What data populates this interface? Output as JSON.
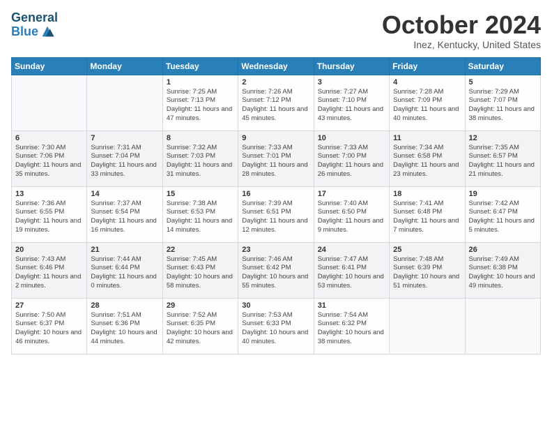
{
  "header": {
    "logo_line1": "General",
    "logo_line2": "Blue",
    "month": "October 2024",
    "location": "Inez, Kentucky, United States"
  },
  "days_of_week": [
    "Sunday",
    "Monday",
    "Tuesday",
    "Wednesday",
    "Thursday",
    "Friday",
    "Saturday"
  ],
  "weeks": [
    [
      {
        "day": "",
        "info": ""
      },
      {
        "day": "",
        "info": ""
      },
      {
        "day": "1",
        "info": "Sunrise: 7:25 AM\nSunset: 7:13 PM\nDaylight: 11 hours and 47 minutes."
      },
      {
        "day": "2",
        "info": "Sunrise: 7:26 AM\nSunset: 7:12 PM\nDaylight: 11 hours and 45 minutes."
      },
      {
        "day": "3",
        "info": "Sunrise: 7:27 AM\nSunset: 7:10 PM\nDaylight: 11 hours and 43 minutes."
      },
      {
        "day": "4",
        "info": "Sunrise: 7:28 AM\nSunset: 7:09 PM\nDaylight: 11 hours and 40 minutes."
      },
      {
        "day": "5",
        "info": "Sunrise: 7:29 AM\nSunset: 7:07 PM\nDaylight: 11 hours and 38 minutes."
      }
    ],
    [
      {
        "day": "6",
        "info": "Sunrise: 7:30 AM\nSunset: 7:06 PM\nDaylight: 11 hours and 35 minutes."
      },
      {
        "day": "7",
        "info": "Sunrise: 7:31 AM\nSunset: 7:04 PM\nDaylight: 11 hours and 33 minutes."
      },
      {
        "day": "8",
        "info": "Sunrise: 7:32 AM\nSunset: 7:03 PM\nDaylight: 11 hours and 31 minutes."
      },
      {
        "day": "9",
        "info": "Sunrise: 7:33 AM\nSunset: 7:01 PM\nDaylight: 11 hours and 28 minutes."
      },
      {
        "day": "10",
        "info": "Sunrise: 7:33 AM\nSunset: 7:00 PM\nDaylight: 11 hours and 26 minutes."
      },
      {
        "day": "11",
        "info": "Sunrise: 7:34 AM\nSunset: 6:58 PM\nDaylight: 11 hours and 23 minutes."
      },
      {
        "day": "12",
        "info": "Sunrise: 7:35 AM\nSunset: 6:57 PM\nDaylight: 11 hours and 21 minutes."
      }
    ],
    [
      {
        "day": "13",
        "info": "Sunrise: 7:36 AM\nSunset: 6:55 PM\nDaylight: 11 hours and 19 minutes."
      },
      {
        "day": "14",
        "info": "Sunrise: 7:37 AM\nSunset: 6:54 PM\nDaylight: 11 hours and 16 minutes."
      },
      {
        "day": "15",
        "info": "Sunrise: 7:38 AM\nSunset: 6:53 PM\nDaylight: 11 hours and 14 minutes."
      },
      {
        "day": "16",
        "info": "Sunrise: 7:39 AM\nSunset: 6:51 PM\nDaylight: 11 hours and 12 minutes."
      },
      {
        "day": "17",
        "info": "Sunrise: 7:40 AM\nSunset: 6:50 PM\nDaylight: 11 hours and 9 minutes."
      },
      {
        "day": "18",
        "info": "Sunrise: 7:41 AM\nSunset: 6:48 PM\nDaylight: 11 hours and 7 minutes."
      },
      {
        "day": "19",
        "info": "Sunrise: 7:42 AM\nSunset: 6:47 PM\nDaylight: 11 hours and 5 minutes."
      }
    ],
    [
      {
        "day": "20",
        "info": "Sunrise: 7:43 AM\nSunset: 6:46 PM\nDaylight: 11 hours and 2 minutes."
      },
      {
        "day": "21",
        "info": "Sunrise: 7:44 AM\nSunset: 6:44 PM\nDaylight: 11 hours and 0 minutes."
      },
      {
        "day": "22",
        "info": "Sunrise: 7:45 AM\nSunset: 6:43 PM\nDaylight: 10 hours and 58 minutes."
      },
      {
        "day": "23",
        "info": "Sunrise: 7:46 AM\nSunset: 6:42 PM\nDaylight: 10 hours and 55 minutes."
      },
      {
        "day": "24",
        "info": "Sunrise: 7:47 AM\nSunset: 6:41 PM\nDaylight: 10 hours and 53 minutes."
      },
      {
        "day": "25",
        "info": "Sunrise: 7:48 AM\nSunset: 6:39 PM\nDaylight: 10 hours and 51 minutes."
      },
      {
        "day": "26",
        "info": "Sunrise: 7:49 AM\nSunset: 6:38 PM\nDaylight: 10 hours and 49 minutes."
      }
    ],
    [
      {
        "day": "27",
        "info": "Sunrise: 7:50 AM\nSunset: 6:37 PM\nDaylight: 10 hours and 46 minutes."
      },
      {
        "day": "28",
        "info": "Sunrise: 7:51 AM\nSunset: 6:36 PM\nDaylight: 10 hours and 44 minutes."
      },
      {
        "day": "29",
        "info": "Sunrise: 7:52 AM\nSunset: 6:35 PM\nDaylight: 10 hours and 42 minutes."
      },
      {
        "day": "30",
        "info": "Sunrise: 7:53 AM\nSunset: 6:33 PM\nDaylight: 10 hours and 40 minutes."
      },
      {
        "day": "31",
        "info": "Sunrise: 7:54 AM\nSunset: 6:32 PM\nDaylight: 10 hours and 38 minutes."
      },
      {
        "day": "",
        "info": ""
      },
      {
        "day": "",
        "info": ""
      }
    ]
  ]
}
